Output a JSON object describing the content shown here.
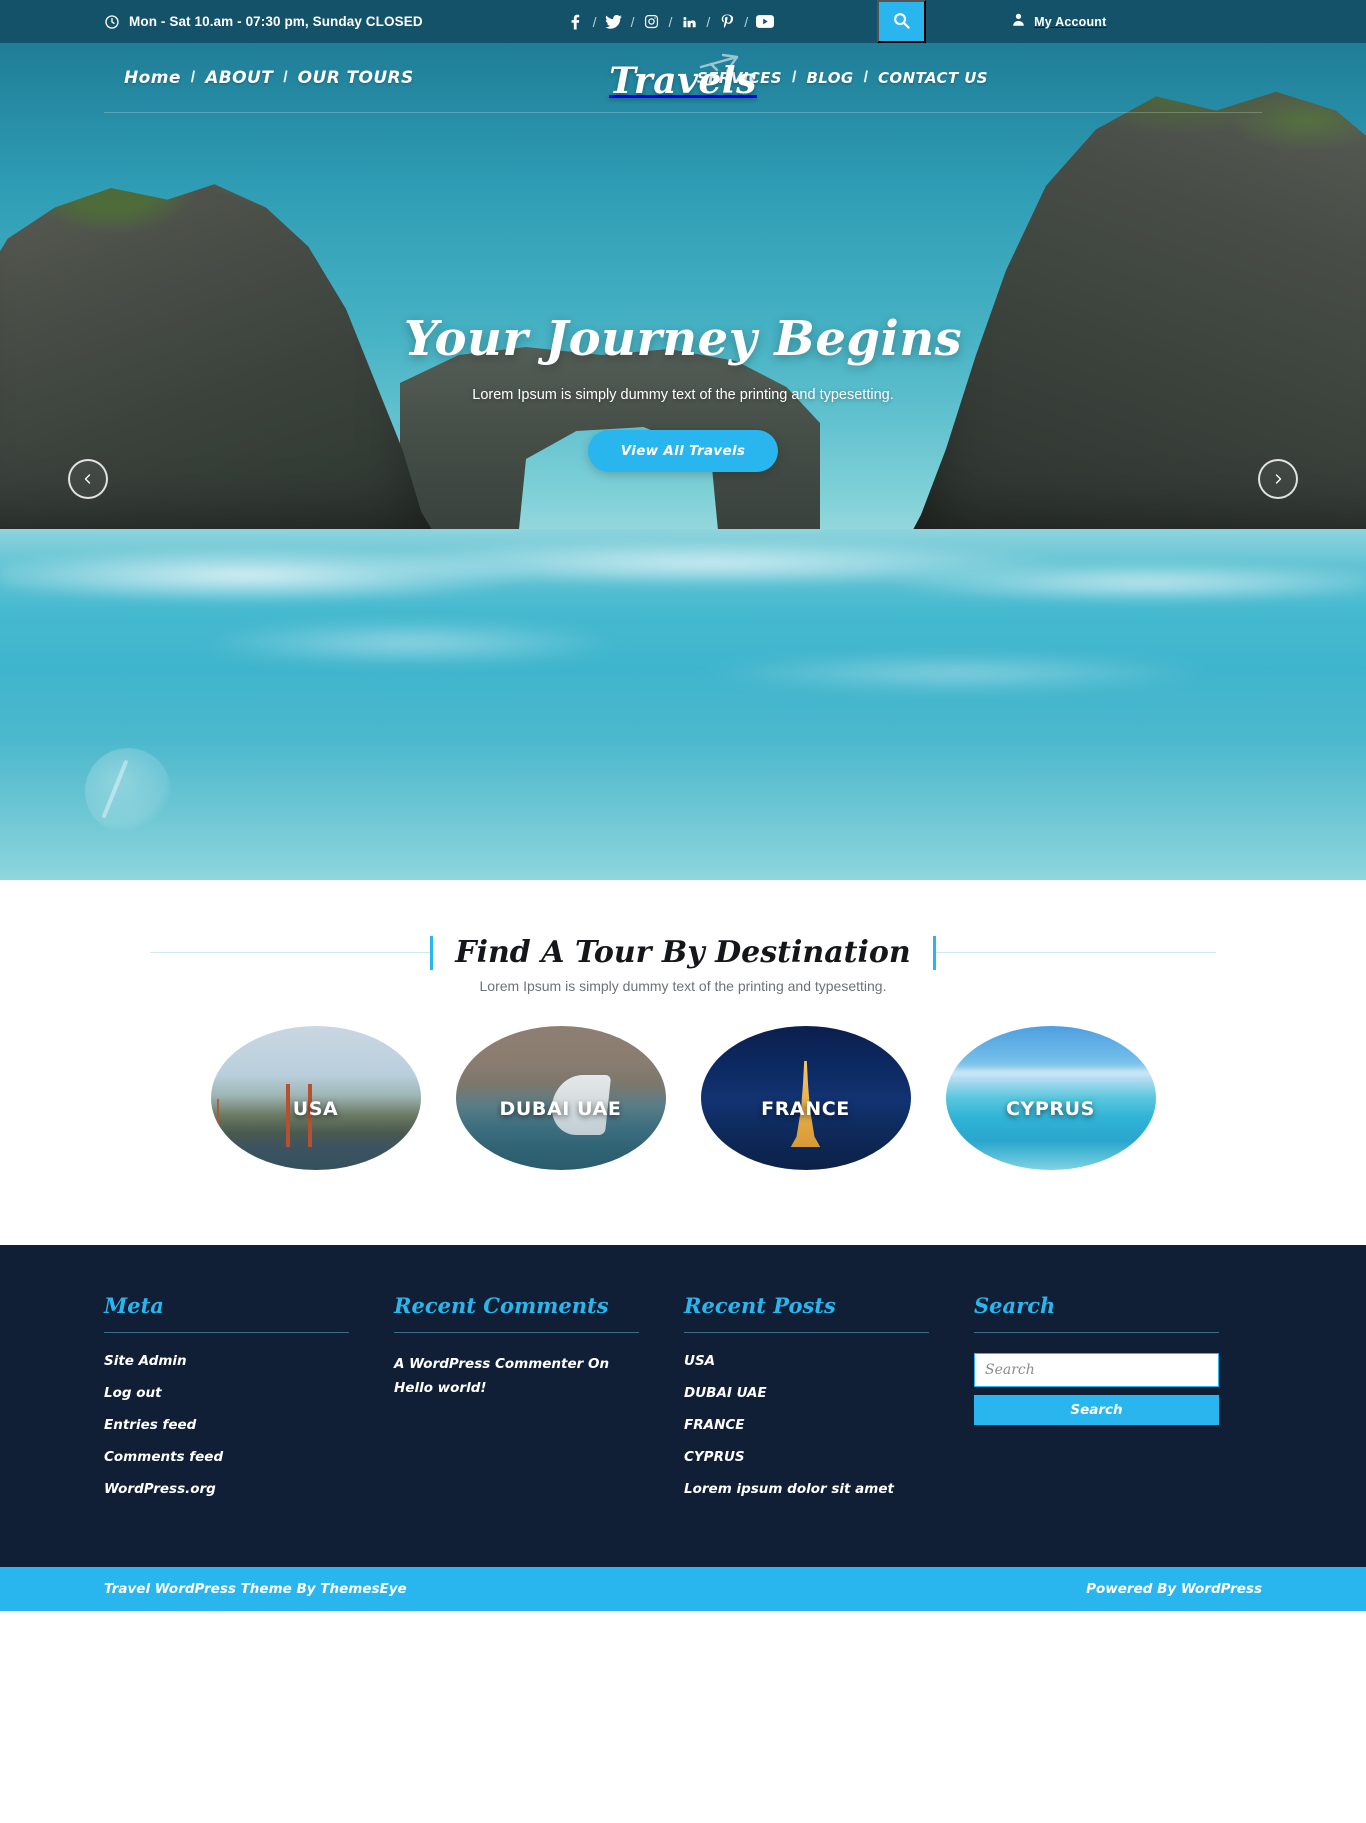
{
  "topbar": {
    "hours": "Mon - Sat 10.am - 07:30 pm, Sunday CLOSED",
    "clock_icon": "clock-icon",
    "separator": "/",
    "socials": [
      {
        "name": "facebook-icon",
        "label": "Facebook"
      },
      {
        "name": "twitter-icon",
        "label": "Twitter"
      },
      {
        "name": "instagram-icon",
        "label": "Instagram"
      },
      {
        "name": "linkedin-icon",
        "label": "LinkedIn"
      },
      {
        "name": "pinterest-icon",
        "label": "Pinterest"
      },
      {
        "name": "youtube-icon",
        "label": "YouTube"
      }
    ],
    "search_icon": "search-icon",
    "account_icon": "user-icon",
    "account_label": "My Account"
  },
  "nav": {
    "logo": "Travels",
    "plane_icon": "airplane-icon",
    "separator": "/",
    "left_items": [
      {
        "label": "Home"
      },
      {
        "label": "ABOUT"
      },
      {
        "label": "OUR TOURS"
      }
    ],
    "right_items": [
      {
        "label": "SERVICES"
      },
      {
        "label": "BLOG"
      },
      {
        "label": "CONTACT US"
      }
    ]
  },
  "hero": {
    "title": "Your Journey Begins",
    "subtitle": "Lorem Ipsum is simply dummy text of the printing and typesetting.",
    "button": "View All Travels",
    "prev_icon": "chevron-left-icon",
    "next_icon": "chevron-right-icon"
  },
  "destinations": {
    "title": "Find A Tour By Destination",
    "subtitle": "Lorem Ipsum is simply dummy text of the printing and typesetting.",
    "items": [
      {
        "label": "USA",
        "image": "golden-gate-bridge"
      },
      {
        "label": "DUBAI UAE",
        "image": "burj-al-arab"
      },
      {
        "label": "FRANCE",
        "image": "eiffel-tower"
      },
      {
        "label": "CYPRUS",
        "image": "tropical-beach"
      }
    ]
  },
  "footer": {
    "meta": {
      "title": "Meta",
      "links": [
        {
          "label": "Site Admin"
        },
        {
          "label": "Log out"
        },
        {
          "label": "Entries feed"
        },
        {
          "label": "Comments feed"
        },
        {
          "label": "WordPress.org"
        }
      ]
    },
    "recent_comments": {
      "title": "Recent Comments",
      "text": "A WordPress Commenter On Hello world!"
    },
    "recent_posts": {
      "title": "Recent Posts",
      "links": [
        {
          "label": "USA"
        },
        {
          "label": "DUBAI UAE"
        },
        {
          "label": "FRANCE"
        },
        {
          "label": "CYPRUS"
        },
        {
          "label": "Lorem ipsum dolor sit amet"
        }
      ]
    },
    "search": {
      "title": "Search",
      "placeholder": "Search",
      "value": "",
      "button": "Search"
    }
  },
  "bottombar": {
    "left": "Travel WordPress Theme By ThemesEye",
    "right": "Powered By WordPress"
  },
  "colors": {
    "accent": "#29b6ee",
    "topbar": "#145269",
    "footer": "#101f35"
  }
}
